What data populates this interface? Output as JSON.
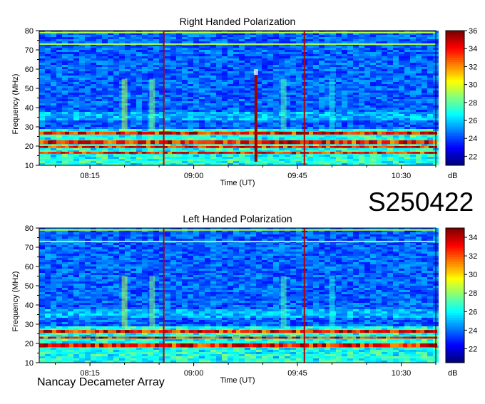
{
  "code": "S250422",
  "source": "Nancay Decameter Array",
  "chart_data": [
    {
      "type": "heatmap",
      "title": "Right Handed Polarization",
      "xlabel": "Time (UT)",
      "ylabel": "Frequency (MHz)",
      "x_ticks": [
        "08:15",
        "09:00",
        "09:45",
        "10:30"
      ],
      "x_tick_minutes": [
        495,
        540,
        585,
        630
      ],
      "xlim_minutes": [
        473,
        645
      ],
      "y_ticks": [
        10,
        20,
        30,
        40,
        50,
        60,
        70,
        80
      ],
      "ylim": [
        10,
        80
      ],
      "colorbar": {
        "ticks": [
          22,
          24,
          26,
          28,
          30,
          32,
          34,
          36
        ],
        "range": [
          21,
          36
        ],
        "unit": "dB"
      },
      "features": {
        "strong_bands_mhz": [
          [
            16,
            17
          ],
          [
            19,
            20
          ],
          [
            21,
            23
          ],
          [
            26,
            27.5
          ]
        ],
        "bright_vertical_lines_min": [
          527,
          588
        ],
        "burst_min": 567,
        "burst_top_mhz": 57
      }
    },
    {
      "type": "heatmap",
      "title": "Left Handed Polarization",
      "xlabel": "Time (UT)",
      "ylabel": "Frequency (MHz)",
      "x_ticks": [
        "08:15",
        "09:00",
        "09:45",
        "10:30"
      ],
      "x_tick_minutes": [
        495,
        540,
        585,
        630
      ],
      "xlim_minutes": [
        473,
        645
      ],
      "y_ticks": [
        10,
        20,
        30,
        40,
        50,
        60,
        70,
        80
      ],
      "ylim": [
        10,
        80
      ],
      "colorbar": {
        "ticks": [
          22,
          24,
          26,
          28,
          30,
          32,
          34
        ],
        "range": [
          20.5,
          35
        ],
        "unit": "dB"
      },
      "features": {
        "strong_bands_mhz": [
          [
            18,
            20
          ],
          [
            22.5,
            23.5
          ],
          [
            25.5,
            27
          ]
        ],
        "bright_vertical_lines_min": [
          527,
          588
        ]
      }
    }
  ]
}
